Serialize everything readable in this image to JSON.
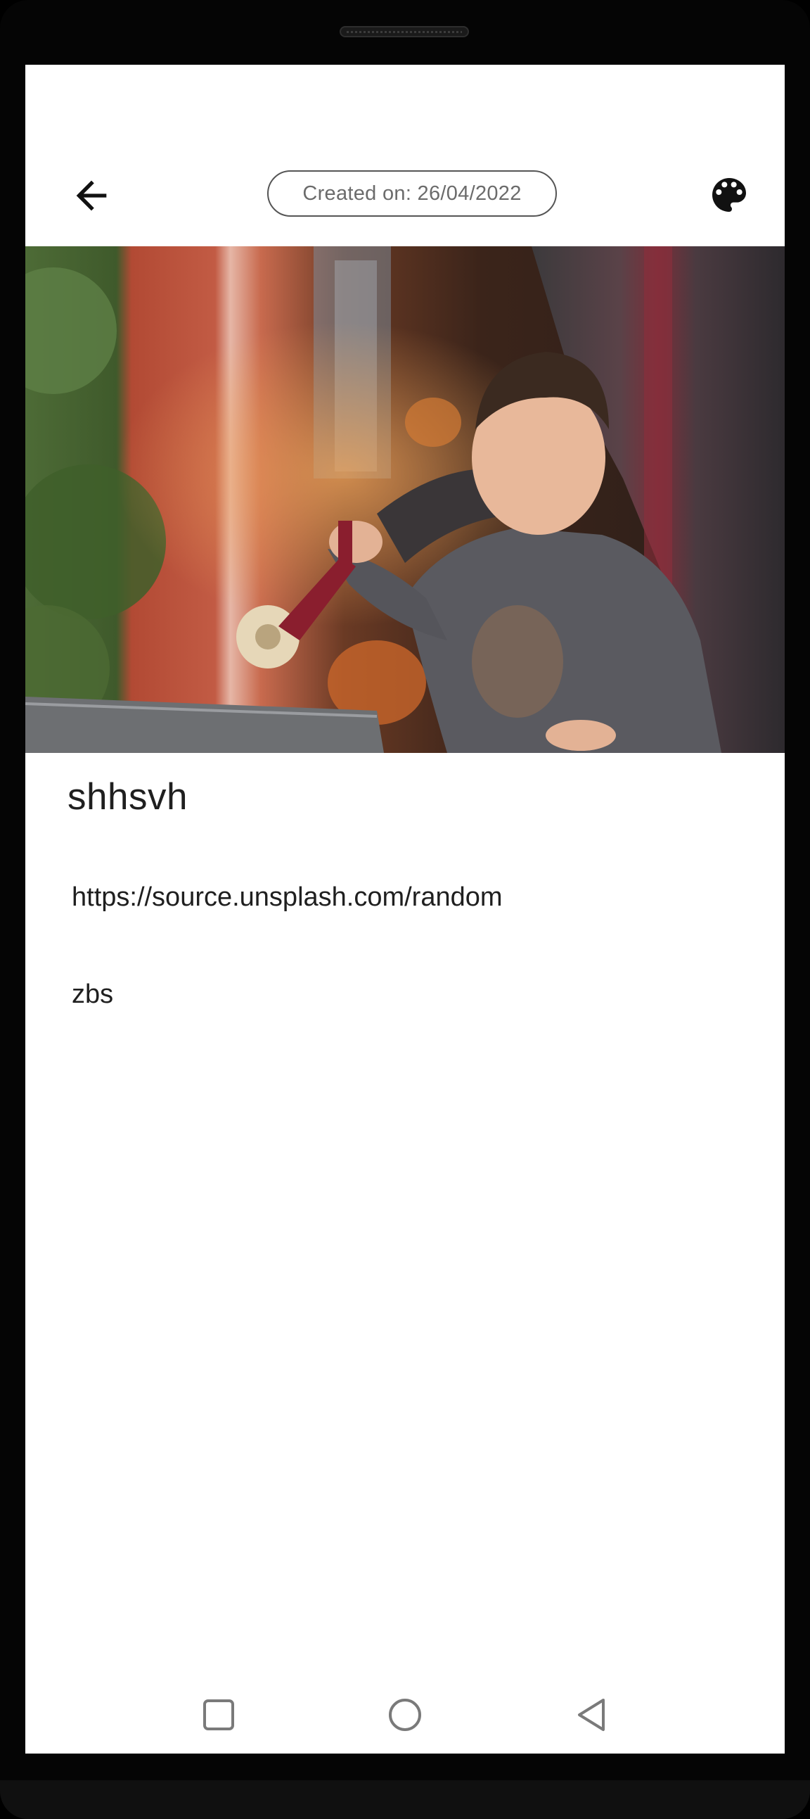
{
  "header": {
    "back_icon": "arrow-back-icon",
    "created_label": "Created on: 26/04/2022",
    "palette_icon": "palette-icon"
  },
  "note": {
    "title": "shhsvh",
    "lines": [
      "https://source.unsplash.com/random",
      "zbs"
    ]
  },
  "navbar": {
    "recents_icon": "square-icon",
    "home_icon": "circle-icon",
    "back_icon": "triangle-back-icon"
  },
  "colors": {
    "background": "#ffffff",
    "text": "#1f1f1f",
    "chip_border": "#555555",
    "chip_text": "#6b6b6b",
    "nav_icon": "#7a7a7a"
  }
}
